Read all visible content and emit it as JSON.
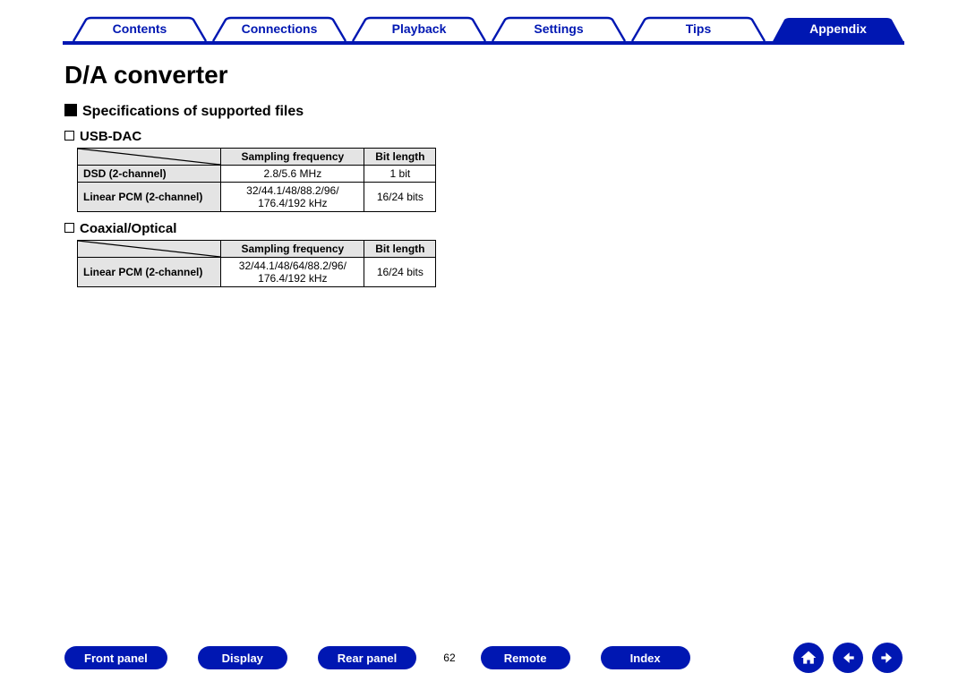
{
  "top_nav": {
    "tabs": [
      {
        "label": "Contents",
        "active": false
      },
      {
        "label": "Connections",
        "active": false
      },
      {
        "label": "Playback",
        "active": false
      },
      {
        "label": "Settings",
        "active": false
      },
      {
        "label": "Tips",
        "active": false
      },
      {
        "label": "Appendix",
        "active": true
      }
    ]
  },
  "page": {
    "title": "D/A converter",
    "section_title": "Specifications of supported files",
    "usb_dac": {
      "heading": "USB-DAC",
      "col1": "Sampling frequency",
      "col2": "Bit length",
      "rows": [
        {
          "label": "DSD (2-channel)",
          "freq": "2.8/5.6 MHz",
          "bits": "1 bit"
        },
        {
          "label": "Linear PCM (2-channel)",
          "freq": "32/44.1/48/88.2/96/\n176.4/192 kHz",
          "bits": "16/24 bits"
        }
      ]
    },
    "coax": {
      "heading": "Coaxial/Optical",
      "col1": "Sampling frequency",
      "col2": "Bit length",
      "rows": [
        {
          "label": "Linear PCM (2-channel)",
          "freq": "32/44.1/48/64/88.2/96/\n176.4/192 kHz",
          "bits": "16/24 bits"
        }
      ]
    }
  },
  "bottom_nav": {
    "buttons": [
      {
        "label": "Front panel"
      },
      {
        "label": "Display"
      },
      {
        "label": "Rear panel"
      }
    ],
    "page_number": "62",
    "buttons2": [
      {
        "label": "Remote"
      },
      {
        "label": "Index"
      }
    ],
    "icons": [
      "home",
      "prev",
      "next"
    ]
  }
}
